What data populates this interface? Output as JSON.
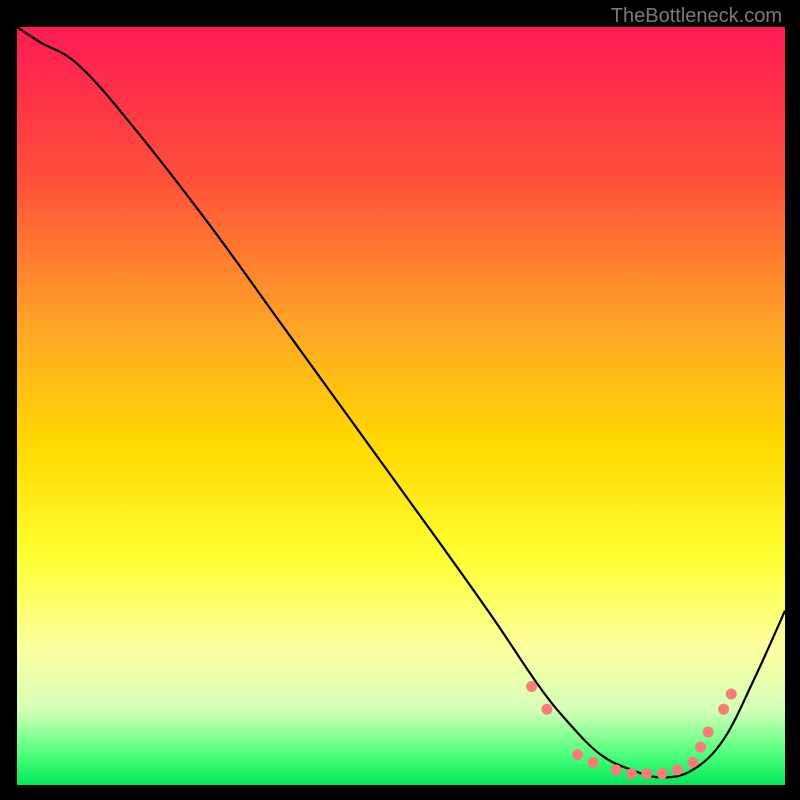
{
  "watermark": "TheBottleneck.com",
  "chart_data": {
    "type": "line",
    "title": "",
    "xlabel": "",
    "ylabel": "",
    "xlim": [
      0,
      100
    ],
    "ylim": [
      0,
      100
    ],
    "gradient_stops": [
      {
        "offset": 0,
        "color": "#ff1a54"
      },
      {
        "offset": 20,
        "color": "#ff4f3a"
      },
      {
        "offset": 40,
        "color": "#ffa726"
      },
      {
        "offset": 55,
        "color": "#ffd900"
      },
      {
        "offset": 70,
        "color": "#ffff33"
      },
      {
        "offset": 82,
        "color": "#fbffa0"
      },
      {
        "offset": 90,
        "color": "#d6ffb8"
      },
      {
        "offset": 96,
        "color": "#4cff7a"
      },
      {
        "offset": 100,
        "color": "#00e85a"
      }
    ],
    "series": [
      {
        "name": "bottleneck-curve",
        "x": [
          0,
          3,
          8,
          15,
          25,
          35,
          45,
          55,
          62,
          68,
          72,
          76,
          80,
          84,
          88,
          92,
          96,
          100
        ],
        "y": [
          100,
          98,
          95,
          87,
          74,
          60,
          46,
          32,
          22,
          13,
          8,
          4,
          2,
          1,
          2,
          6,
          14,
          23
        ]
      }
    ],
    "markers": {
      "name": "highlight-dots",
      "color": "#fb7b7b",
      "x": [
        67,
        69,
        73,
        75,
        78,
        80,
        82,
        84,
        86,
        88,
        89,
        90,
        92,
        93
      ],
      "y": [
        13,
        10,
        4,
        3,
        2,
        1.5,
        1.5,
        1.5,
        2,
        3,
        5,
        7,
        10,
        12
      ]
    }
  }
}
